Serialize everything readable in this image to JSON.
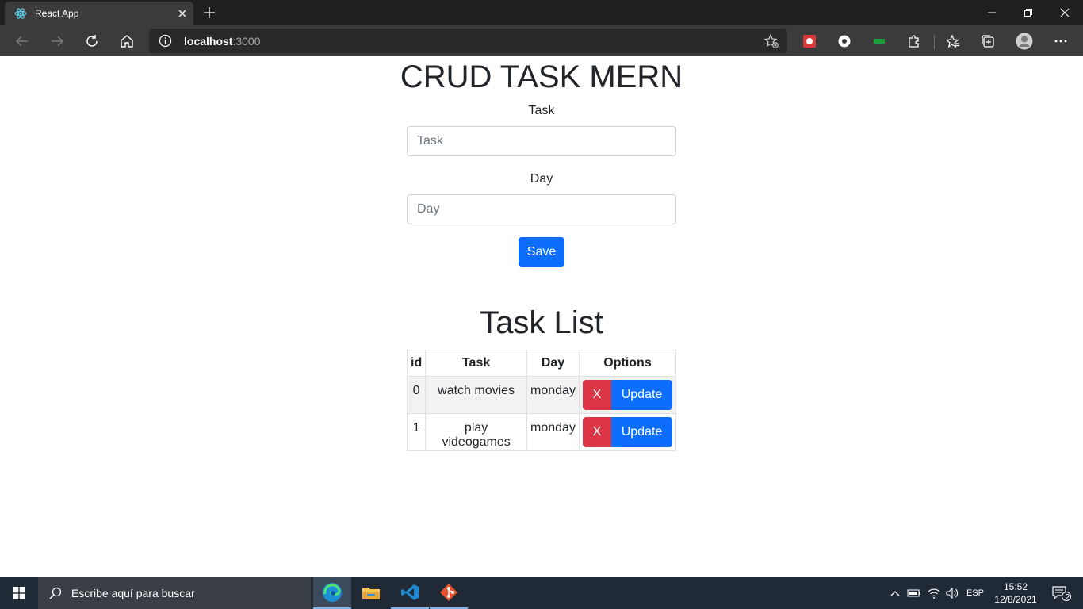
{
  "browser": {
    "tab_title": "React App",
    "url_host": "localhost",
    "url_port": ":3000"
  },
  "page": {
    "title": "CRUD TASK MERN",
    "form": {
      "task_label": "Task",
      "task_placeholder": "Task",
      "day_label": "Day",
      "day_placeholder": "Day",
      "save_label": "Save"
    },
    "list_title": "Task List",
    "table": {
      "headers": [
        "id",
        "Task",
        "Day",
        "Options"
      ],
      "rows": [
        {
          "id": "0",
          "task": "watch movies",
          "day": "monday",
          "delete_label": "X",
          "update_label": "Update"
        },
        {
          "id": "1",
          "task": "play videogames",
          "day": "monday",
          "delete_label": "X",
          "update_label": "Update"
        }
      ]
    }
  },
  "taskbar": {
    "search_placeholder": "Escribe aquí para buscar",
    "language": "ESP",
    "time": "15:52",
    "date": "12/8/2021",
    "notification_count": "2"
  },
  "colors": {
    "primary": "#0d6efd",
    "danger": "#dc3545",
    "chrome_dark": "#202020",
    "chrome_toolbar": "#3b3b3b",
    "taskbar": "#1f2a36"
  }
}
